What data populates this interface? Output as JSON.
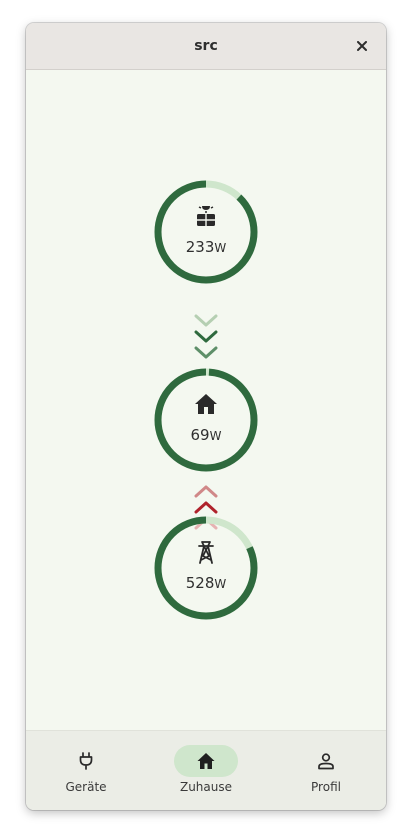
{
  "window": {
    "title": "src"
  },
  "flow": {
    "solar": {
      "value": "233",
      "unit": "W",
      "icon": "solar-panel-icon",
      "level": 0.88
    },
    "home": {
      "value": "69",
      "unit": "W",
      "icon": "home-icon",
      "level": 0.99
    },
    "grid": {
      "value": "528",
      "unit": "W",
      "icon": "power-tower-icon",
      "level": 0.82
    },
    "arrow_down_colors": [
      "#b5cfb2",
      "#2f6a3e",
      "#5e8f69"
    ],
    "arrow_up_colors": [
      "#d08888",
      "#b0232c",
      "#e6b2b2"
    ],
    "ring_color": "#2f6a3e",
    "ring_track_color": "#cfe6cc"
  },
  "nav": {
    "items": [
      {
        "label": "Geräte",
        "icon": "plug-icon",
        "active": false
      },
      {
        "label": "Zuhause",
        "icon": "home-icon",
        "active": true
      },
      {
        "label": "Profil",
        "icon": "person-icon",
        "active": false
      }
    ]
  }
}
